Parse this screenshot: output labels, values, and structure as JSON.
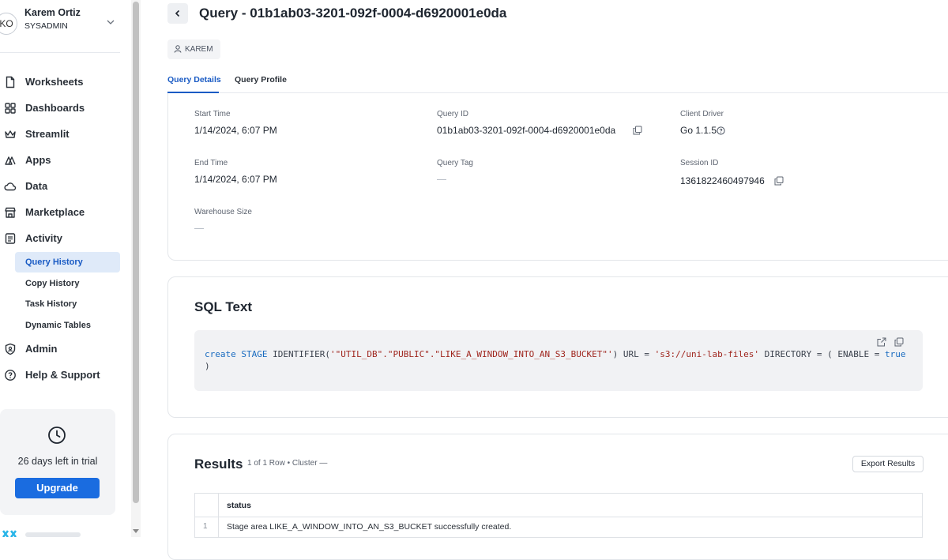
{
  "sidebar": {
    "user": {
      "initials": "KO",
      "name": "Karem Ortiz",
      "role": "SYSADMIN"
    },
    "nav": [
      {
        "label": "Worksheets",
        "icon": "file-icon"
      },
      {
        "label": "Dashboards",
        "icon": "grid-icon"
      },
      {
        "label": "Streamlit",
        "icon": "crown-icon"
      },
      {
        "label": "Apps",
        "icon": "apps-icon"
      },
      {
        "label": "Data",
        "icon": "cloud-icon"
      },
      {
        "label": "Marketplace",
        "icon": "store-icon"
      },
      {
        "label": "Activity",
        "icon": "activity-icon"
      }
    ],
    "activity_sub": [
      "Query History",
      "Copy History",
      "Task History",
      "Dynamic Tables"
    ],
    "active_sub": "Query History",
    "nav_bottom": [
      {
        "label": "Admin",
        "icon": "shield-icon"
      },
      {
        "label": "Help & Support",
        "icon": "help-icon"
      }
    ],
    "trial": {
      "text": "26 days left in trial",
      "button": "Upgrade"
    }
  },
  "header": {
    "title": "Query - 01b1ab03-3201-092f-0004-d6920001e0da",
    "user_chip": "KAREM"
  },
  "tabs": [
    "Query Details",
    "Query Profile"
  ],
  "active_tab": "Query Details",
  "details": {
    "start_time": {
      "label": "Start Time",
      "value": "1/14/2024, 6:07 PM"
    },
    "query_id": {
      "label": "Query ID",
      "value": "01b1ab03-3201-092f-0004-d6920001e0da"
    },
    "client_driver": {
      "label": "Client Driver",
      "value": "Go 1.1.5"
    },
    "end_time": {
      "label": "End Time",
      "value": "1/14/2024, 6:07 PM"
    },
    "query_tag": {
      "label": "Query Tag",
      "value": ""
    },
    "session_id": {
      "label": "Session ID",
      "value": "1361822460497946"
    },
    "warehouse_size": {
      "label": "Warehouse Size",
      "value": ""
    }
  },
  "sql": {
    "title": "SQL Text",
    "tokens": [
      {
        "t": "create",
        "c": "kw"
      },
      {
        "t": " ",
        "c": ""
      },
      {
        "t": "STAGE",
        "c": "kw"
      },
      {
        "t": " IDENTIFIER(",
        "c": ""
      },
      {
        "t": "'\"UTIL_DB\".\"PUBLIC\".\"LIKE_A_WINDOW_INTO_AN_S3_BUCKET\"'",
        "c": "str"
      },
      {
        "t": ") URL = ",
        "c": ""
      },
      {
        "t": "'s3://uni-lab-files'",
        "c": "str"
      },
      {
        "t": " DIRECTORY = ( ENABLE = ",
        "c": ""
      },
      {
        "t": "true",
        "c": "kw"
      },
      {
        "t": " )",
        "c": ""
      }
    ]
  },
  "results": {
    "title": "Results",
    "meta": "1 of 1 Row • Cluster —",
    "export_label": "Export Results",
    "columns": [
      "status"
    ],
    "rows": [
      {
        "index": "1",
        "status": "Stage area LIKE_A_WINDOW_INTO_AN_S3_BUCKET successfully created."
      }
    ]
  }
}
